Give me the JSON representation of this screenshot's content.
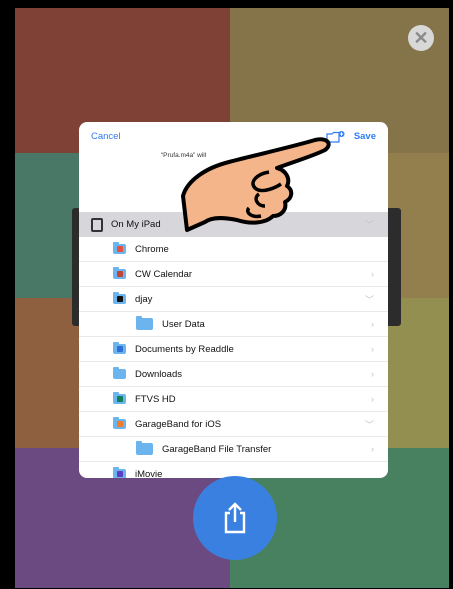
{
  "header": {
    "cancel_label": "Cancel",
    "save_label": "Save",
    "hint_text": "“Prufa.m4a” will"
  },
  "location": {
    "label": "On My iPad"
  },
  "folders": [
    {
      "label": "Chrome",
      "chevron": "",
      "indent": 1,
      "badge": "#e8503d"
    },
    {
      "label": "CW Calendar",
      "chevron": ">",
      "indent": 1,
      "badge": "#c2453a"
    },
    {
      "label": "djay",
      "chevron": "v",
      "indent": 1,
      "badge": "#111111"
    },
    {
      "label": "User Data",
      "chevron": ">",
      "indent": 2,
      "badge": ""
    },
    {
      "label": "Documents by Readdle",
      "chevron": ">",
      "indent": 1,
      "badge": "#2e6fd6"
    },
    {
      "label": "Downloads",
      "chevron": ">",
      "indent": 1,
      "badge": ""
    },
    {
      "label": "FTVS HD",
      "chevron": ">",
      "indent": 1,
      "badge": "#0f7f5a"
    },
    {
      "label": "GarageBand for iOS",
      "chevron": "v",
      "indent": 1,
      "badge": "#f07c2a"
    },
    {
      "label": "GarageBand File Transfer",
      "chevron": ">",
      "indent": 2,
      "badge": ""
    },
    {
      "label": "iMovie",
      "chevron": "",
      "indent": 1,
      "badge": "#5a3fc2"
    }
  ],
  "icons": {
    "close": "close-icon",
    "new_folder": "new-folder-icon",
    "share": "share-icon",
    "ipad": "ipad-icon",
    "hand": "pointing-hand-icon"
  },
  "colors": {
    "accent": "#2f7cf6",
    "share_button": "#3a80e0"
  }
}
